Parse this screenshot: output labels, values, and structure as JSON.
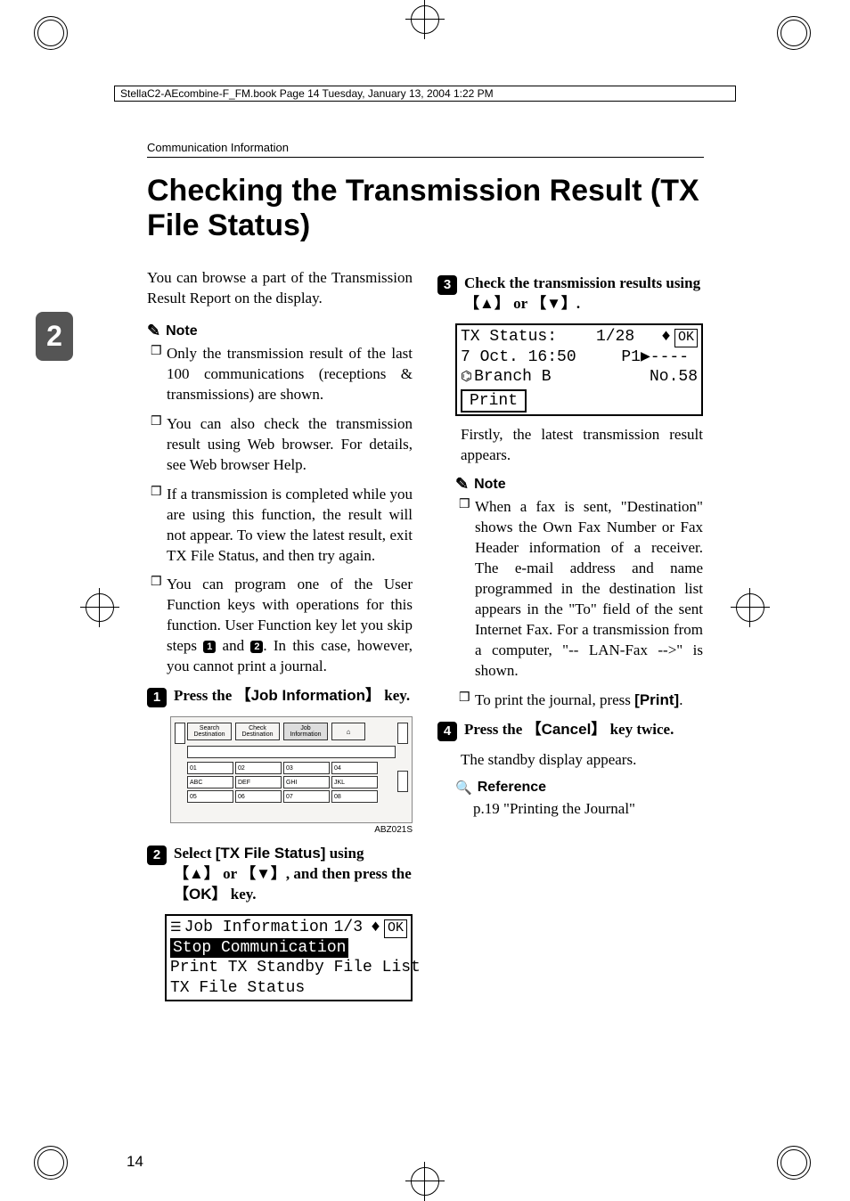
{
  "book_frame": "StellaC2-AEcombine-F_FM.book  Page 14  Tuesday, January 13, 2004  1:22 PM",
  "running_header": "Communication Information",
  "title": "Checking the Transmission Result (TX File Status)",
  "side_tab": "2",
  "page_number": "14",
  "left": {
    "intro": "You can browse a part of the Transmission Result Report on the display.",
    "note_heading": "Note",
    "notes": [
      "Only the transmission result of the last 100 communications (receptions & transmissions) are shown.",
      "You can also check the transmission result using Web browser. For details, see Web browser Help.",
      "If a transmission is completed while you are using this function, the result will not appear. To view the latest result, exit TX File Status, and then try again.",
      "You can program one of the User Function keys with operations for this function. User Function key let you skip steps 1 and 2. In this case, however, you cannot print a journal."
    ],
    "step1_prefix": "Press the ",
    "step1_key": "Job Information",
    "step1_suffix": " key.",
    "panel": {
      "btn1": "Search Destination",
      "btn2": "Check Destination",
      "btn3": "Job Information",
      "cells_top": [
        "01",
        "02",
        "03",
        "04"
      ],
      "cells_mid": [
        "ABC",
        "DEF",
        "GHI",
        "JKL"
      ],
      "cells_mid2": [
        "05",
        "06",
        "07",
        "08"
      ]
    },
    "image_caption": "ABZ021S",
    "step2_prefix": "Select ",
    "step2_item": "[TX File Status]",
    "step2_mid1": " using ",
    "step2_arrow1": "【▲】",
    "step2_or": " or ",
    "step2_arrow2": "【▼】",
    "step2_mid2": ", and then press the ",
    "step2_key": "OK",
    "step2_suffix": " key.",
    "lcd1": {
      "line1_label": "Job Information",
      "line1_page": "1/3",
      "line1_ok": "OK",
      "line2": "Stop Communication",
      "line3": "Print TX Standby File List",
      "line4": "TX File Status"
    }
  },
  "right": {
    "step3_prefix": "Check the transmission results using ",
    "step3_arrow1": "【▲】",
    "step3_or": " or ",
    "step3_arrow2": "【▼】",
    "step3_suffix": ".",
    "lcd2": {
      "line1_label": "TX Status:",
      "line1_page": "1/28",
      "line1_ok": "OK",
      "line2_left": "7 Oct. 16:50",
      "line2_right": "P1▶----",
      "line3_left": "Branch B",
      "line3_right": "No.58",
      "line4_btn": "Print"
    },
    "para1": "Firstly, the latest transmission result appears.",
    "note_heading": "Note",
    "notes": [
      "When a fax is sent, \"Destination\" shows the Own Fax Number or Fax Header information of a receiver. The e-mail address and name programmed in the destination list appears in the \"To\" field of the sent Internet Fax. For a transmission from a computer, \"-- LAN-Fax -->\" is shown.",
      "To print the journal, press [Print]."
    ],
    "step4_prefix": "Press the ",
    "step4_key": "Cancel",
    "step4_suffix": " key twice.",
    "para2": "The standby display appears.",
    "ref_heading": "Reference",
    "ref_text": "p.19 \"Printing the Journal\""
  }
}
